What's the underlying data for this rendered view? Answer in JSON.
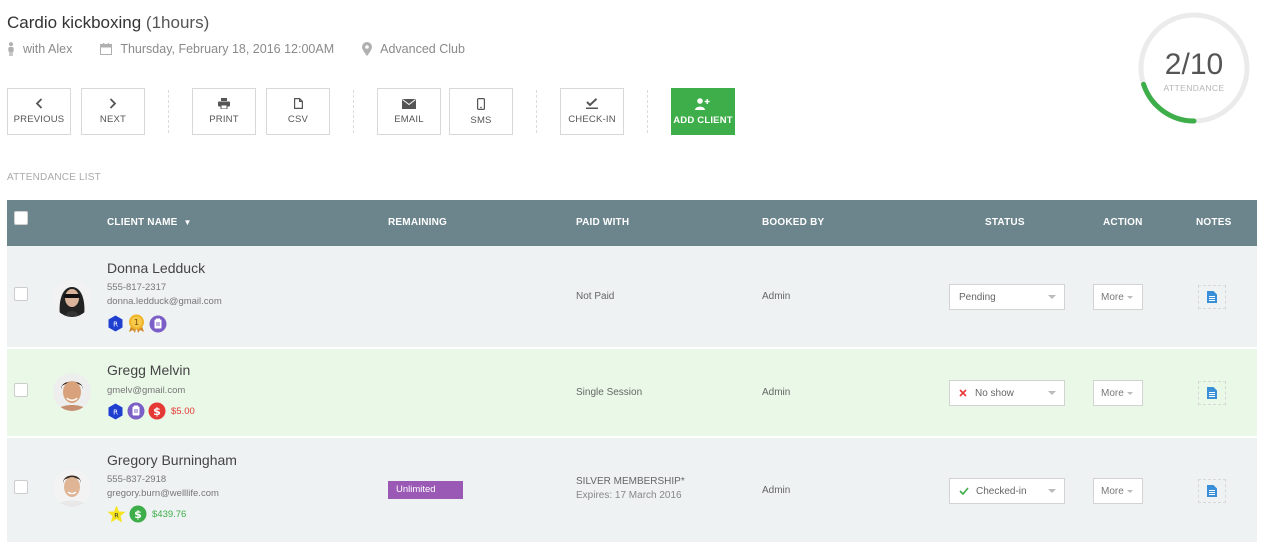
{
  "header": {
    "class_name": "Cardio kickboxing",
    "duration": "(1hours)",
    "instructor": "with  Alex",
    "datetime": "Thursday, February 18, 2016 12:00AM",
    "location": "Advanced Club"
  },
  "toolbar": {
    "previous": "PREVIOUS",
    "next": "NEXT",
    "print": "PRINT",
    "csv": "CSV",
    "email": "EMAIL",
    "sms": "SMS",
    "checkin": "CHECK-IN",
    "add_client": "ADD CLIENT"
  },
  "attendance": {
    "value": "2/10",
    "label": "ATTENDANCE",
    "fraction": 0.2,
    "color": "#3dae49"
  },
  "section_label": "ATTENDANCE LIST",
  "table": {
    "columns": {
      "client_name": "CLIENT NAME",
      "sort_indicator": "▼",
      "remaining": "REMAINING",
      "paid_with": "PAID WITH",
      "booked_by": "BOOKED BY",
      "status": "STATUS",
      "action": "ACTION",
      "notes": "NOTES"
    },
    "rows": [
      {
        "name": "Donna Ledduck",
        "phone": "555-817-2317",
        "email": "donna.ledduck@gmail.com",
        "remaining": "",
        "paid_with": "Not Paid",
        "booked_by": "Admin",
        "status": "Pending",
        "action": "More",
        "badges": [
          "R",
          "1"
        ],
        "amount": ""
      },
      {
        "name": "Gregg Melvin",
        "email": "gmelv@gmail.com",
        "remaining": "",
        "paid_with": "Single Session",
        "booked_by": "Admin",
        "status": "No show",
        "action": "More",
        "badges": [
          "R",
          "$"
        ],
        "amount": "$5.00",
        "amount_color": "#e53935"
      },
      {
        "name": "Gregory Burningham",
        "phone": "555-837-2918",
        "email": "gregory.burn@welllife.com",
        "remaining": "Unlimited",
        "paid_with": "SILVER MEMBERSHIP*",
        "paid_sub": "Expires: 17 March 2016",
        "booked_by": "Admin",
        "status": "Checked-in",
        "action": "More",
        "badges": [
          "R",
          "$"
        ],
        "amount": "$439.76",
        "amount_color": "#3dae49"
      }
    ]
  }
}
